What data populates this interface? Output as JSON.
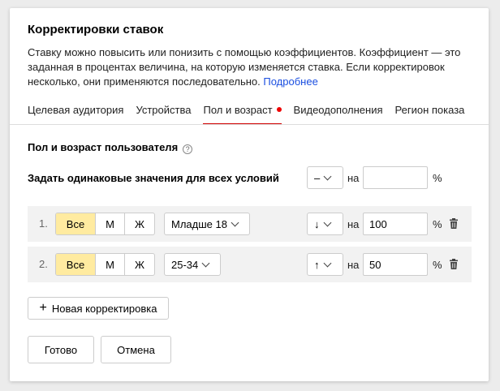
{
  "dialog": {
    "title": "Корректировки ставок",
    "description": "Ставку можно повысить или понизить с помощью коэффициентов. Коэффициент — это заданная в процентах величина, на которую изменяется ставка. Если корректировок несколько, они применяются последовательно.",
    "more_link": "Подробнее"
  },
  "tabs": [
    {
      "label": "Целевая аудитория",
      "active": false
    },
    {
      "label": "Устройства",
      "active": false
    },
    {
      "label": "Пол и возраст",
      "active": true
    },
    {
      "label": "Видеодополнения",
      "active": false
    },
    {
      "label": "Регион показа",
      "active": false
    }
  ],
  "section": {
    "title": "Пол и возраст пользователя",
    "help_icon": "question-circle-icon",
    "same_label": "Задать одинаковые значения для всех условий",
    "same_direction": "–",
    "on_label": "на",
    "same_value": "",
    "percent": "%"
  },
  "rows": [
    {
      "num": "1.",
      "gender": [
        "Все",
        "М",
        "Ж"
      ],
      "gender_selected": "Все",
      "age": "Младше 18",
      "direction": "↓",
      "on_label": "на",
      "value": "100",
      "percent": "%"
    },
    {
      "num": "2.",
      "gender": [
        "Все",
        "М",
        "Ж"
      ],
      "gender_selected": "Все",
      "age": "25-34",
      "direction": "↑",
      "on_label": "на",
      "value": "50",
      "percent": "%"
    }
  ],
  "actions": {
    "add": "Новая корректировка",
    "done": "Готово",
    "cancel": "Отмена"
  },
  "colors": {
    "accent_tab": "#d10000",
    "selected_segment": "#ffeba0",
    "link": "#1a4ee0"
  }
}
